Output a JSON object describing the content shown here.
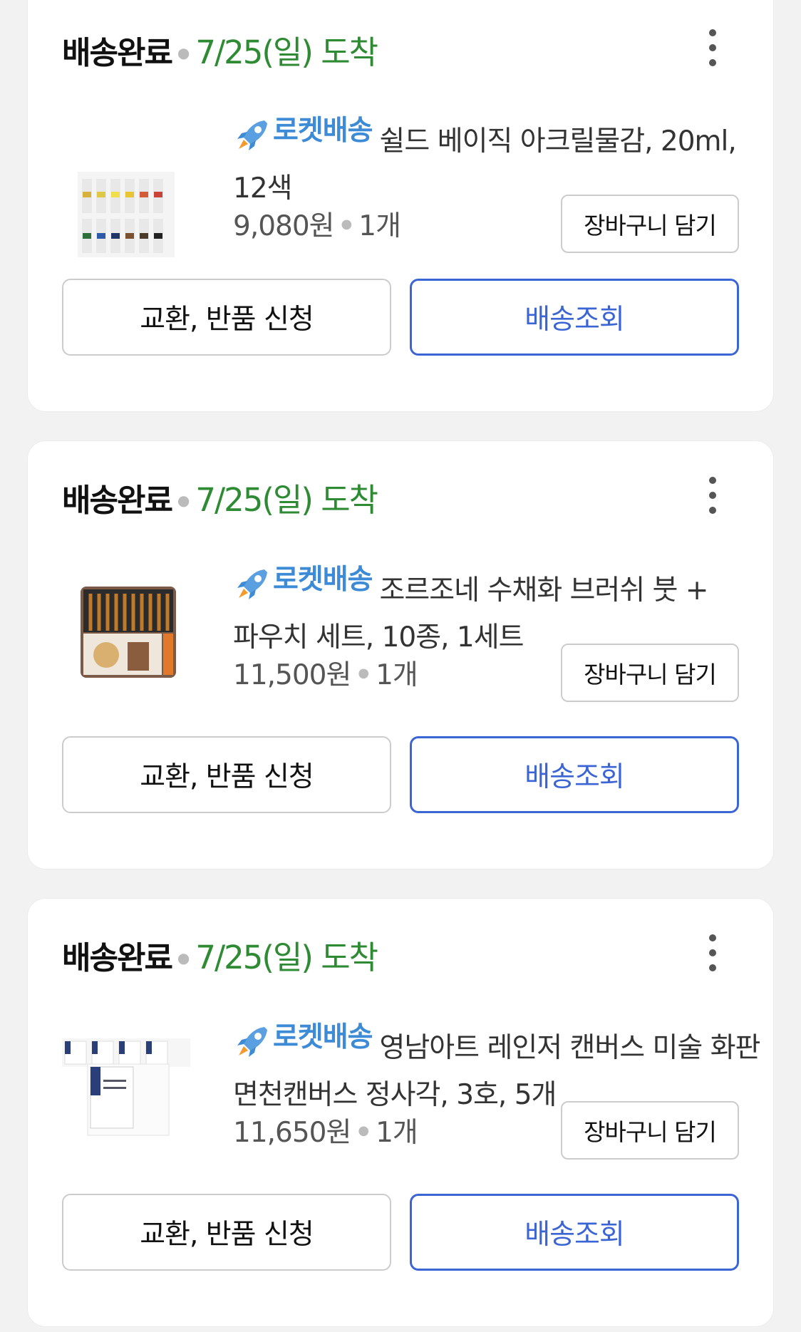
{
  "orders": [
    {
      "status": "배송완료",
      "arrival": "7/25(일) 도착",
      "badge": "로켓배송",
      "title": "쉴드 베이직 아크릴물감, 20ml, 12색",
      "price": "9,080원",
      "qty": "1개",
      "cart_label": "장바구니 담기",
      "exchange_label": "교환, 반품 신청",
      "track_label": "배송조회"
    },
    {
      "status": "배송완료",
      "arrival": "7/25(일) 도착",
      "badge": "로켓배송",
      "title": "조르조네 수채화 브러쉬 붓 + 파우치 세트, 10종, 1세트",
      "price": "11,500원",
      "qty": "1개",
      "cart_label": "장바구니 담기",
      "exchange_label": "교환, 반품 신청",
      "track_label": "배송조회"
    },
    {
      "status": "배송완료",
      "arrival": "7/25(일) 도착",
      "badge": "로켓배송",
      "title": "영남아트 레인저 캔버스 미술 화판 면천캔버스 정사각, 3호, 5개",
      "price": "11,650원",
      "qty": "1개",
      "cart_label": "장바구니 담기",
      "exchange_label": "교환, 반품 신청",
      "track_label": "배송조회"
    }
  ],
  "icons": {
    "more": "more-vertical-icon",
    "rocket": "rocket-icon"
  },
  "colors": {
    "arrival_green": "#2e8b33",
    "rocket_blue": "#3d8bd6",
    "track_blue": "#3b65d4"
  }
}
